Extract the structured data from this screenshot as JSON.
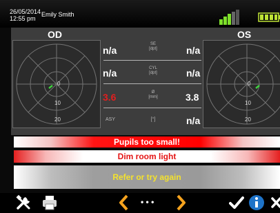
{
  "header": {
    "date": "26/05/2014",
    "time": "12:55 pm",
    "user": "Emily Smith"
  },
  "panel": {
    "od_label": "OD",
    "os_label": "OS",
    "plot_labels": {
      "zero": "0",
      "ten": "10",
      "twenty": "20"
    },
    "rows": [
      {
        "param": "SE",
        "unit": "[dpt]",
        "od": "n/a",
        "os": "n/a"
      },
      {
        "param": "CYL",
        "unit": "[dpt]",
        "od": "n/a",
        "os": "n/a"
      },
      {
        "param": "Ø",
        "unit": "[mm]",
        "od": "3.6",
        "os": "3.8"
      },
      {
        "param": "ASY",
        "unit": "[°]",
        "od": "",
        "os": "n/a"
      }
    ]
  },
  "messages": {
    "pupils": "Pupils too small!",
    "dim": "Dim room light",
    "refer": "Refer or try again"
  },
  "toolbar": {
    "more": "• • •"
  },
  "colors": {
    "accent_orange": "#f6a31e",
    "alert_red": "#ff0000",
    "info_blue": "#1e73c8",
    "signal_green": "#7ee02a"
  }
}
